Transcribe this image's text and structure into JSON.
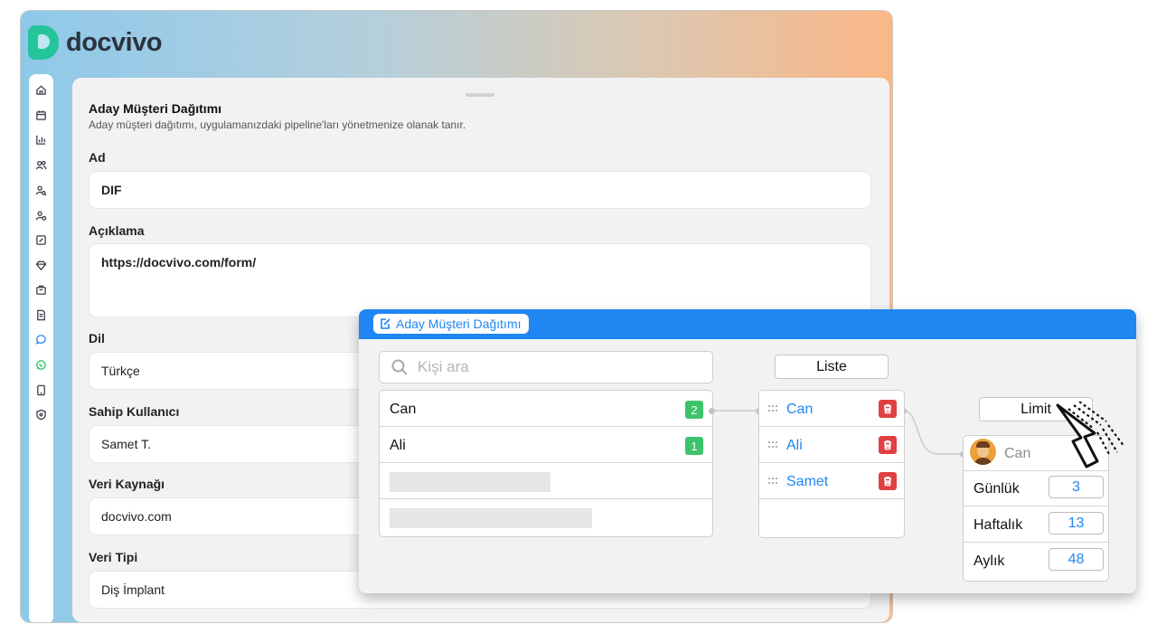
{
  "brand": {
    "name": "docvivo"
  },
  "sidebar": {
    "icons": [
      "home-icon",
      "calendar-icon",
      "chart-icon",
      "users-icon",
      "user-search-icon",
      "user-settings-icon",
      "report-icon",
      "diamond-icon",
      "bag-icon",
      "document-icon",
      "chat-icon",
      "whatsapp-icon",
      "tablet-icon",
      "shield-icon"
    ]
  },
  "form": {
    "title": "Aday Müşteri Dağıtımı",
    "subtitle": "Aday müşteri dağıtımı, uygulamanızdaki pipeline'ları yönetmenize olanak tanır.",
    "name_label": "Ad",
    "name_value": "DIF",
    "desc_label": "Açıklama",
    "desc_value": "https://docvivo.com/form/",
    "lang_label": "Dil",
    "lang_value": "Türkçe",
    "owner_label": "Sahip Kullanıcı",
    "owner_value": "Samet T.",
    "source_label": "Veri Kaynağı",
    "source_value": "docvivo.com",
    "type_label": "Veri Tipi",
    "type_value": "Diş İmplant"
  },
  "dialog": {
    "title": "Aday Müşteri Dağıtımı",
    "search_placeholder": "Kişi ara",
    "people": [
      {
        "name": "Can",
        "count": "2"
      },
      {
        "name": "Ali",
        "count": "1"
      }
    ],
    "list_button": "Liste",
    "list_items": [
      "Can",
      "Ali",
      "Samet"
    ],
    "limit_button": "Limit",
    "limit_card": {
      "name": "Can",
      "rows": [
        {
          "label": "Günlük",
          "value": "3"
        },
        {
          "label": "Haftalık",
          "value": "13"
        },
        {
          "label": "Aylık",
          "value": "48"
        }
      ]
    }
  },
  "colors": {
    "accent": "#1f86f2",
    "badge": "#3cc46b",
    "danger": "#e04040",
    "brand": "#25c49a"
  }
}
